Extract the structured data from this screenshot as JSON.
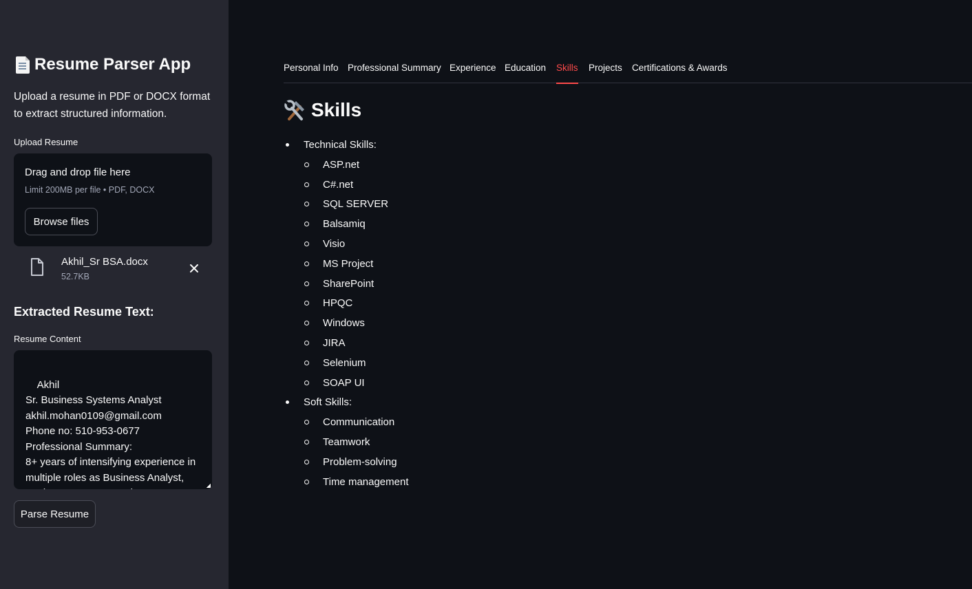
{
  "sidebar": {
    "app_title": "Resume Parser App",
    "intro": "Upload a resume in PDF or DOCX format to extract structured information.",
    "upload_label": "Upload Resume",
    "dropzone": {
      "title": "Drag and drop file here",
      "limit": "Limit 200MB per file • PDF, DOCX",
      "browse_label": "Browse files"
    },
    "file": {
      "name": "Akhil_Sr BSA.docx",
      "size": "52.7KB"
    },
    "extracted_heading": "Extracted Resume Text:",
    "content_label": "Resume Content",
    "content_text": "Akhil\nSr. Business Systems Analyst\nakhil.mohan0109@gmail.com\nPhone no: 510-953-0677\nProfessional Summary:\n8+ years of intensifying experience in multiple roles as Business Analyst, Business Systems Analyst, Scrum",
    "parse_label": "Parse Resume"
  },
  "tabs": [
    {
      "label": "Personal Info",
      "active": false
    },
    {
      "label": "Professional Summary",
      "active": false
    },
    {
      "label": "Experience",
      "active": false
    },
    {
      "label": "Education",
      "active": false
    },
    {
      "label": "Skills",
      "active": true
    },
    {
      "label": "Projects",
      "active": false
    },
    {
      "label": "Certifications & Awards",
      "active": false
    }
  ],
  "main": {
    "title": "Skills",
    "groups": [
      {
        "label": "Technical Skills:",
        "items": [
          "ASP.net",
          "C#.net",
          "SQL SERVER",
          "Balsamiq",
          "Visio",
          "MS Project",
          "SharePoint",
          "HPQC",
          "Windows",
          "JIRA",
          "Selenium",
          "SOAP UI"
        ]
      },
      {
        "label": "Soft Skills:",
        "items": [
          "Communication",
          "Teamwork",
          "Problem-solving",
          "Time management"
        ]
      }
    ]
  },
  "colors": {
    "sidebar_bg": "#262730",
    "main_bg": "#0e1117",
    "accent": "#ff4b4b"
  },
  "icons": {
    "title_icon": "page-facing-up-icon",
    "skills_icon": "hammer-and-wrench-icon",
    "file_icon": "file-icon",
    "remove_icon": "close-icon"
  }
}
